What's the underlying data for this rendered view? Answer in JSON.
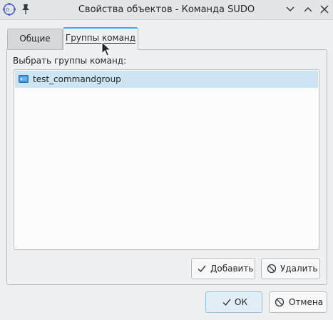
{
  "window": {
    "title": "Свойства объектов - Команда SUDO"
  },
  "tabs": [
    {
      "label": "Общие",
      "active": false
    },
    {
      "label": "Группы команд",
      "active": true
    }
  ],
  "groups_section": {
    "label": "Выбрать группы команд:",
    "items": [
      {
        "label": "test_commandgroup",
        "icon": "command-group-icon",
        "selected": true
      }
    ],
    "add_label": "Добавить",
    "delete_label": "Удалить"
  },
  "dialog": {
    "ok_label": "ОК",
    "cancel_label": "Отмена"
  },
  "colors": {
    "accent": "#3daee9",
    "selection": "#cde4f3",
    "window_bg": "#eff0f1"
  }
}
